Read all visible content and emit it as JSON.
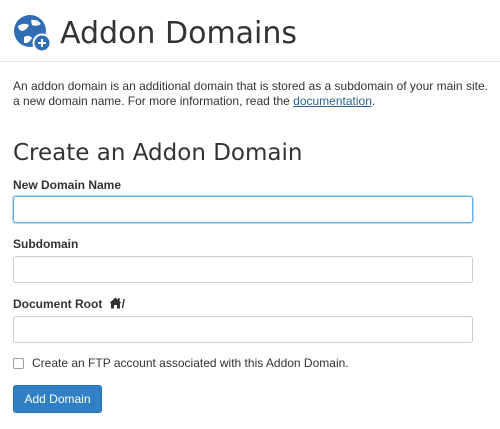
{
  "page": {
    "title": "Addon Domains",
    "description_line1": "An addon domain is an additional domain that is stored as a subdomain of your main site.",
    "description_line2_before": "a new domain name. For more information, read the ",
    "description_link": "documentation",
    "description_line2_after": "."
  },
  "form": {
    "section_title": "Create an Addon Domain",
    "new_domain_label": "New Domain Name",
    "new_domain_value": "",
    "subdomain_label": "Subdomain",
    "subdomain_value": "",
    "document_root_label": "Document Root",
    "document_root_suffix": "/",
    "document_root_value": "",
    "ftp_checkbox_label": "Create an FTP account associated with this Addon Domain.",
    "ftp_checkbox_checked": false,
    "submit_label": "Add Domain"
  },
  "colors": {
    "primary_button": "#3080c6",
    "logo_blue": "#2f6db5",
    "link": "#2a6496",
    "focus_border": "#66afe9"
  },
  "icons": {
    "header_icon": "globe-plus-icon",
    "document_root_icon": "home-icon"
  }
}
